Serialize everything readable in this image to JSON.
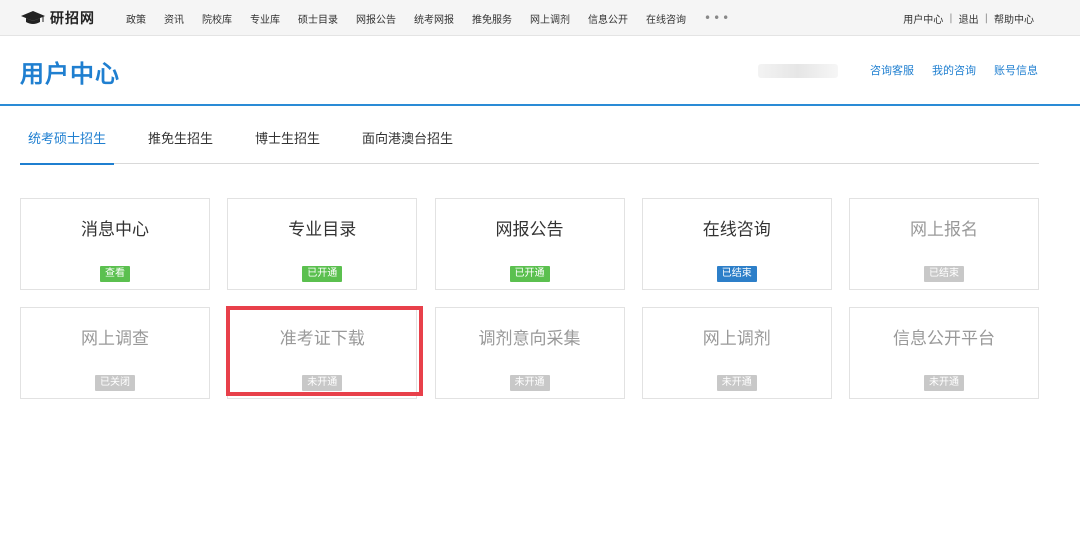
{
  "site": {
    "logo_text": "研招网"
  },
  "nav": {
    "items": [
      "政策",
      "资讯",
      "院校库",
      "专业库",
      "硕士目录",
      "网报公告",
      "统考网报",
      "推免服务",
      "网上调剂",
      "信息公开",
      "在线咨询"
    ],
    "more": "•••"
  },
  "toplinks": {
    "user_center": "用户中心",
    "logout": "退出",
    "help": "帮助中心",
    "separator": "|"
  },
  "header": {
    "title": "用户中心",
    "links": [
      "咨询客服",
      "我的咨询",
      "账号信息"
    ]
  },
  "tabs": [
    {
      "label": "统考硕士招生",
      "active": true
    },
    {
      "label": "推免生招生",
      "active": false
    },
    {
      "label": "博士生招生",
      "active": false
    },
    {
      "label": "面向港澳台招生",
      "active": false
    }
  ],
  "cards": [
    {
      "name": "消息中心",
      "status": "查看",
      "status_color": "#5bc04f",
      "enabled": true
    },
    {
      "name": "专业目录",
      "status": "已开通",
      "status_color": "#5bc04f",
      "enabled": true
    },
    {
      "name": "网报公告",
      "status": "已开通",
      "status_color": "#5bc04f",
      "enabled": true
    },
    {
      "name": "在线咨询",
      "status": "已结束",
      "status_color": "#2d7fc9",
      "enabled": true
    },
    {
      "name": "网上报名",
      "status": "已结束",
      "status_color": "#c8c8c8",
      "enabled": false
    },
    {
      "name": "网上调查",
      "status": "已关闭",
      "status_color": "#c8c8c8",
      "enabled": false
    },
    {
      "name": "准考证下载",
      "status": "未开通",
      "status_color": "#c8c8c8",
      "enabled": false
    },
    {
      "name": "调剂意向采集",
      "status": "未开通",
      "status_color": "#c8c8c8",
      "enabled": false
    },
    {
      "name": "网上调剂",
      "status": "未开通",
      "status_color": "#c8c8c8",
      "enabled": false
    },
    {
      "name": "信息公开平台",
      "status": "未开通",
      "status_color": "#c8c8c8",
      "enabled": false
    }
  ],
  "highlighted_card": "准考证下载",
  "highlight_color": "#e8404a"
}
